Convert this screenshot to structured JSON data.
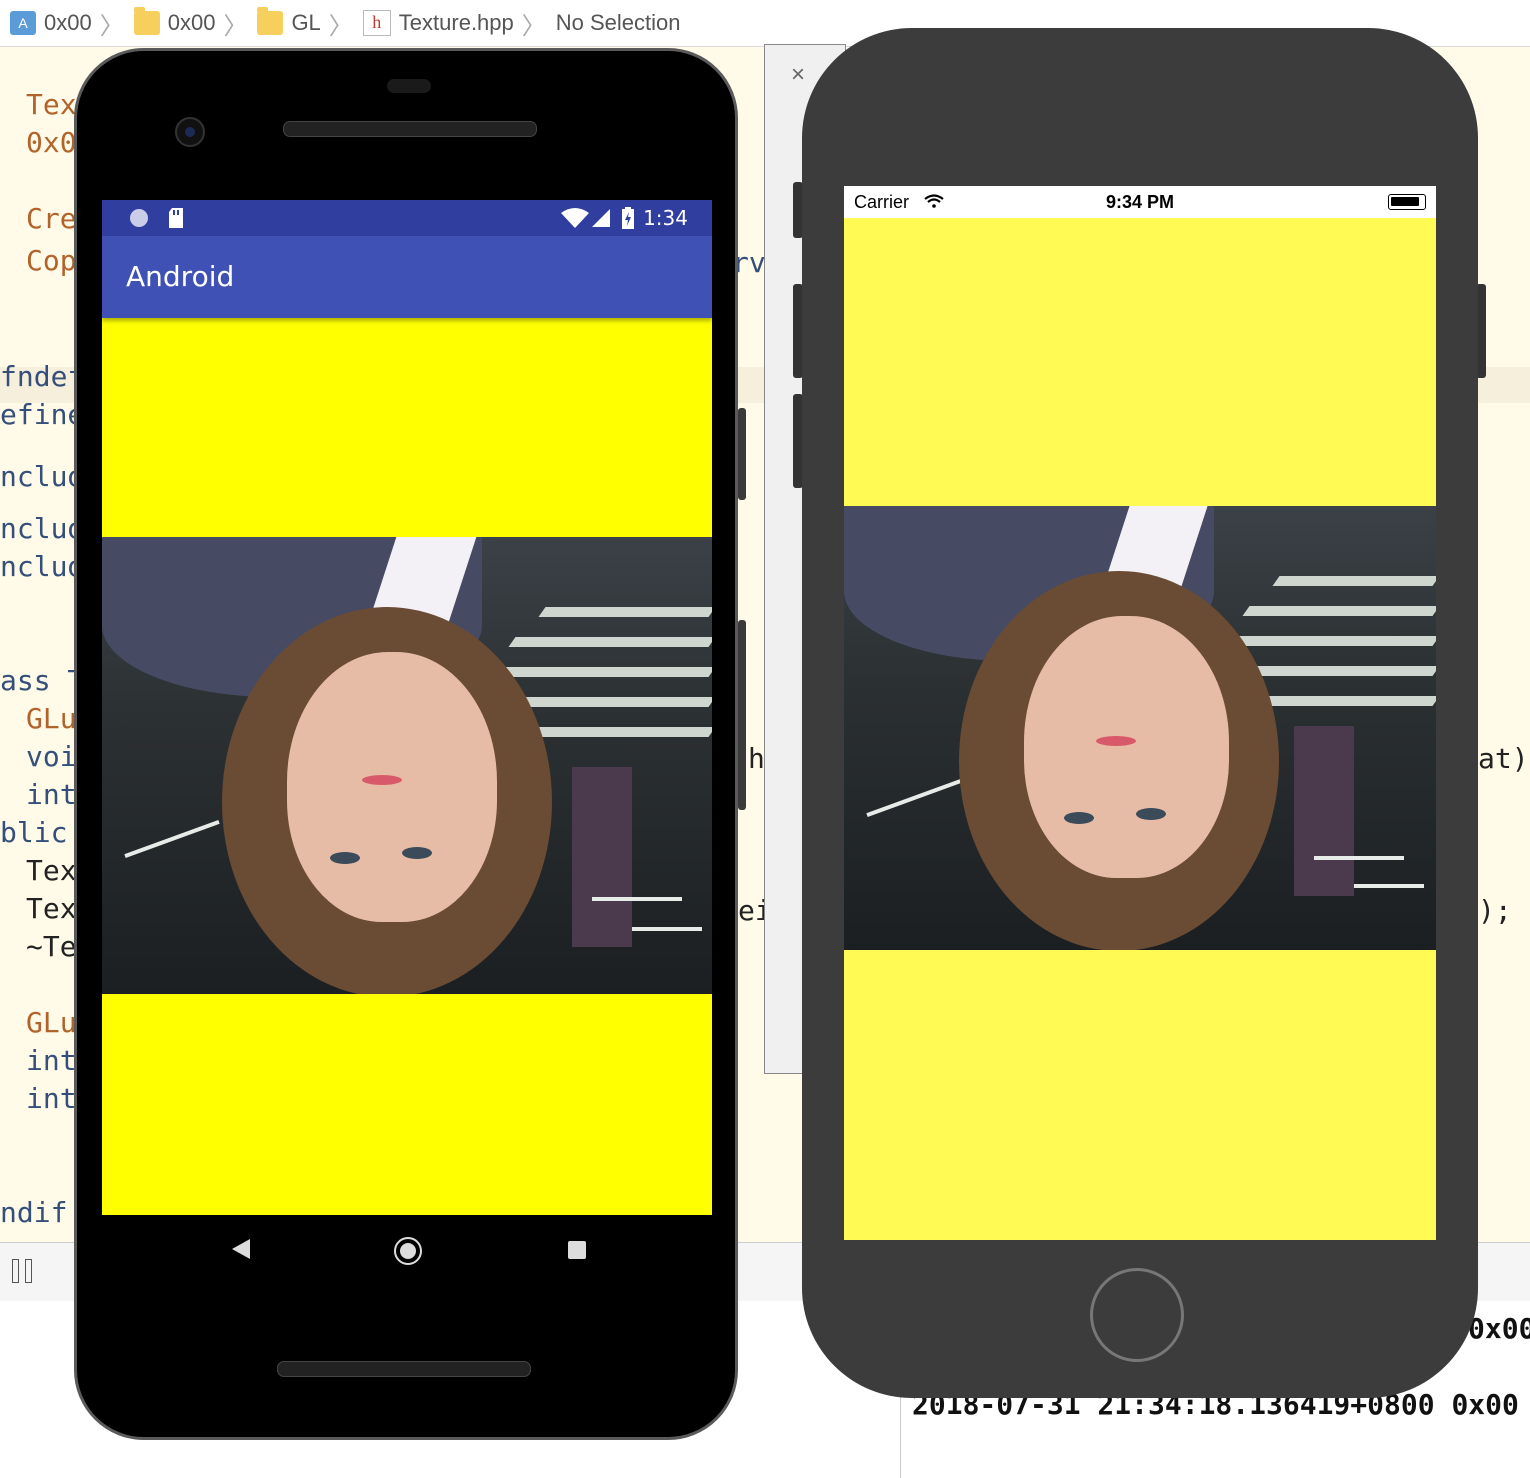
{
  "jumpbar": {
    "crumbs": [
      {
        "label": "0x00",
        "icon": "project-icon"
      },
      {
        "label": "0x00",
        "icon": "folder-icon"
      },
      {
        "label": "GL",
        "icon": "folder-icon"
      },
      {
        "label": "Texture.hpp",
        "icon": "header-file-icon"
      },
      {
        "label": "No Selection",
        "icon": ""
      }
    ]
  },
  "editor": {
    "lines_left": [
      {
        "text": "Tex",
        "style": "kw"
      },
      {
        "text": "0x0",
        "style": "kw"
      },
      {
        "text": "Cre",
        "style": "kw"
      },
      {
        "text": "Cop",
        "style": "kw"
      },
      {
        "text": "fndef",
        "style": "dark"
      },
      {
        "text": "efine",
        "style": "dark"
      },
      {
        "text": "nclud",
        "style": "dark"
      },
      {
        "text": "nclud",
        "style": "dark"
      },
      {
        "text": "nclud",
        "style": "dark"
      },
      {
        "text": "ass T",
        "style": "dark"
      },
      {
        "text": "GLu",
        "style": "kw"
      },
      {
        "text": "voi",
        "style": "dark"
      },
      {
        "text": "int",
        "style": "dark"
      },
      {
        "text": "blic:",
        "style": "dark"
      },
      {
        "text": "Tex",
        "style": "black"
      },
      {
        "text": "Tex",
        "style": "black"
      },
      {
        "text": "~Te",
        "style": "black"
      },
      {
        "text": "GLu",
        "style": "kw"
      },
      {
        "text": "int",
        "style": "dark"
      },
      {
        "text": "int",
        "style": "dark"
      },
      {
        "text": "ndif",
        "style": "dark"
      }
    ],
    "mid_fragments": [
      "rv",
      "h",
      "ei"
    ],
    "right_fragments": [
      "at)",
      ");"
    ]
  },
  "console": {
    "line1": "2018-07-31 21:34:18.136419+0800 0x00",
    "line0_fragment": "0x00"
  },
  "simulator_window": {
    "close_label": "×"
  },
  "android": {
    "status_time": "1:34",
    "status_icons": [
      "circle-icon",
      "sdcard-icon",
      "wifi-icon",
      "signal-icon",
      "battery-charging-icon"
    ],
    "app_title": "Android",
    "nav": [
      "back-icon",
      "home-icon",
      "recents-icon"
    ],
    "colors": {
      "status": "#303f9f",
      "appbar": "#3f51b5",
      "canvas": "#ffff00"
    }
  },
  "iphone": {
    "carrier": "Carrier",
    "time": "9:34 PM",
    "colors": {
      "canvas": "#fffb54",
      "body": "#3c3c3c"
    }
  }
}
